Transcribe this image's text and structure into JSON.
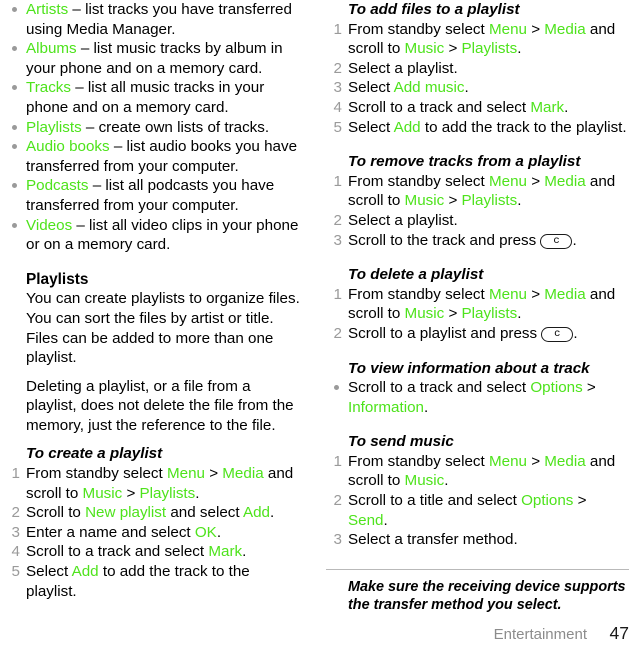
{
  "accent_color": "#4ee31c",
  "muted_color": "#9a9a9a",
  "footer": {
    "chapter": "Entertainment",
    "page_number": "47"
  },
  "left_column": {
    "media_bullets": [
      {
        "term": "Artists",
        "rest": " – list tracks you have transferred using Media Manager."
      },
      {
        "term": "Albums",
        "rest": " – list music tracks by album in your phone and on a memory card."
      },
      {
        "term": "Tracks",
        "rest": " – list all music tracks in your phone and on a memory card."
      },
      {
        "term": "Playlists",
        "rest": " – create own lists of tracks."
      },
      {
        "term": "Audio books",
        "rest": " – list audio books you have transferred from your computer."
      },
      {
        "term": "Podcasts",
        "rest": " – list all podcasts you have transferred from your computer."
      },
      {
        "term": "Videos",
        "rest": " – list all video clips in your phone or on a memory card."
      }
    ],
    "playlists_heading": "Playlists",
    "playlists_para1": "You can create playlists to organize files. You can sort the files by artist or title. Files can be added to more than one playlist.",
    "playlists_para2": "Deleting a playlist, or a file from a playlist, does not delete the file from the memory, just the reference to the file.",
    "create_playlist": {
      "heading": "To create a playlist",
      "steps": [
        {
          "num": "1",
          "parts": [
            {
              "t": "From standby select ",
              "a": false
            },
            {
              "t": "Menu",
              "a": true
            },
            {
              "t": " > ",
              "a": false
            },
            {
              "t": "Media",
              "a": true
            },
            {
              "t": " and scroll to ",
              "a": false
            },
            {
              "t": "Music",
              "a": true
            },
            {
              "t": " > ",
              "a": false
            },
            {
              "t": "Playlists",
              "a": true
            },
            {
              "t": ".",
              "a": false
            }
          ]
        },
        {
          "num": "2",
          "parts": [
            {
              "t": "Scroll to ",
              "a": false
            },
            {
              "t": "New playlist",
              "a": true
            },
            {
              "t": " and select ",
              "a": false
            },
            {
              "t": "Add",
              "a": true
            },
            {
              "t": ".",
              "a": false
            }
          ]
        },
        {
          "num": "3",
          "parts": [
            {
              "t": "Enter a name and select ",
              "a": false
            },
            {
              "t": "OK",
              "a": true
            },
            {
              "t": ".",
              "a": false
            }
          ]
        },
        {
          "num": "4",
          "parts": [
            {
              "t": "Scroll to a track and select ",
              "a": false
            },
            {
              "t": "Mark",
              "a": true
            },
            {
              "t": ".",
              "a": false
            }
          ]
        },
        {
          "num": "5",
          "parts": [
            {
              "t": "Select ",
              "a": false
            },
            {
              "t": "Add",
              "a": true
            },
            {
              "t": " to add the track to the playlist.",
              "a": false
            }
          ]
        }
      ]
    }
  },
  "right_column": {
    "add_files": {
      "heading": "To add files to a playlist",
      "steps": [
        {
          "num": "1",
          "parts": [
            {
              "t": "From standby select ",
              "a": false
            },
            {
              "t": "Menu",
              "a": true
            },
            {
              "t": " > ",
              "a": false
            },
            {
              "t": "Media",
              "a": true
            },
            {
              "t": " and scroll to ",
              "a": false
            },
            {
              "t": "Music",
              "a": true
            },
            {
              "t": " > ",
              "a": false
            },
            {
              "t": "Playlists",
              "a": true
            },
            {
              "t": ".",
              "a": false
            }
          ]
        },
        {
          "num": "2",
          "parts": [
            {
              "t": "Select a playlist.",
              "a": false
            }
          ]
        },
        {
          "num": "3",
          "parts": [
            {
              "t": "Select ",
              "a": false
            },
            {
              "t": "Add music",
              "a": true
            },
            {
              "t": ".",
              "a": false
            }
          ]
        },
        {
          "num": "4",
          "parts": [
            {
              "t": "Scroll to a track and select ",
              "a": false
            },
            {
              "t": "Mark",
              "a": true
            },
            {
              "t": ".",
              "a": false
            }
          ]
        },
        {
          "num": "5",
          "parts": [
            {
              "t": "Select ",
              "a": false
            },
            {
              "t": "Add",
              "a": true
            },
            {
              "t": " to add the track to the playlist.",
              "a": false
            }
          ]
        }
      ]
    },
    "remove_tracks": {
      "heading": "To remove tracks from a playlist",
      "steps": [
        {
          "num": "1",
          "parts": [
            {
              "t": "From standby select ",
              "a": false
            },
            {
              "t": "Menu",
              "a": true
            },
            {
              "t": " > ",
              "a": false
            },
            {
              "t": "Media",
              "a": true
            },
            {
              "t": " and scroll to ",
              "a": false
            },
            {
              "t": "Music",
              "a": true
            },
            {
              "t": " > ",
              "a": false
            },
            {
              "t": "Playlists",
              "a": true
            },
            {
              "t": ".",
              "a": false
            }
          ]
        },
        {
          "num": "2",
          "parts": [
            {
              "t": "Select a playlist.",
              "a": false
            }
          ]
        },
        {
          "num": "3",
          "parts": [
            {
              "t": "Scroll to the track and press ",
              "a": false
            },
            {
              "t": "c",
              "a": false,
              "key": true
            },
            {
              "t": ".",
              "a": false
            }
          ]
        }
      ]
    },
    "delete_playlist": {
      "heading": "To delete a playlist",
      "steps": [
        {
          "num": "1",
          "parts": [
            {
              "t": "From standby select ",
              "a": false
            },
            {
              "t": "Menu",
              "a": true
            },
            {
              "t": " > ",
              "a": false
            },
            {
              "t": "Media",
              "a": true
            },
            {
              "t": " and scroll to ",
              "a": false
            },
            {
              "t": "Music",
              "a": true
            },
            {
              "t": " > ",
              "a": false
            },
            {
              "t": "Playlists",
              "a": true
            },
            {
              "t": ".",
              "a": false
            }
          ]
        },
        {
          "num": "2",
          "parts": [
            {
              "t": "Scroll to a playlist and press ",
              "a": false
            },
            {
              "t": "c",
              "a": false,
              "key": true
            },
            {
              "t": ".",
              "a": false
            }
          ]
        }
      ]
    },
    "view_info": {
      "heading": "To view information about a track",
      "steps": [
        {
          "num": "•",
          "bullet": true,
          "parts": [
            {
              "t": "Scroll to a track and select ",
              "a": false
            },
            {
              "t": "Options",
              "a": true
            },
            {
              "t": " > ",
              "a": false
            },
            {
              "t": "Information",
              "a": true
            },
            {
              "t": ".",
              "a": false
            }
          ]
        }
      ]
    },
    "send_music": {
      "heading": "To send music",
      "steps": [
        {
          "num": "1",
          "parts": [
            {
              "t": "From standby select ",
              "a": false
            },
            {
              "t": "Menu",
              "a": true
            },
            {
              "t": " > ",
              "a": false
            },
            {
              "t": "Media",
              "a": true
            },
            {
              "t": " and scroll to ",
              "a": false
            },
            {
              "t": "Music",
              "a": true
            },
            {
              "t": ".",
              "a": false
            }
          ]
        },
        {
          "num": "2",
          "parts": [
            {
              "t": "Scroll to a title and select ",
              "a": false
            },
            {
              "t": "Options",
              "a": true
            },
            {
              "t": " > ",
              "a": false
            },
            {
              "t": "Send",
              "a": true
            },
            {
              "t": ".",
              "a": false
            }
          ]
        },
        {
          "num": "3",
          "parts": [
            {
              "t": "Select a transfer method.",
              "a": false
            }
          ]
        }
      ]
    },
    "note": "Make sure the receiving device supports the transfer method you select."
  }
}
